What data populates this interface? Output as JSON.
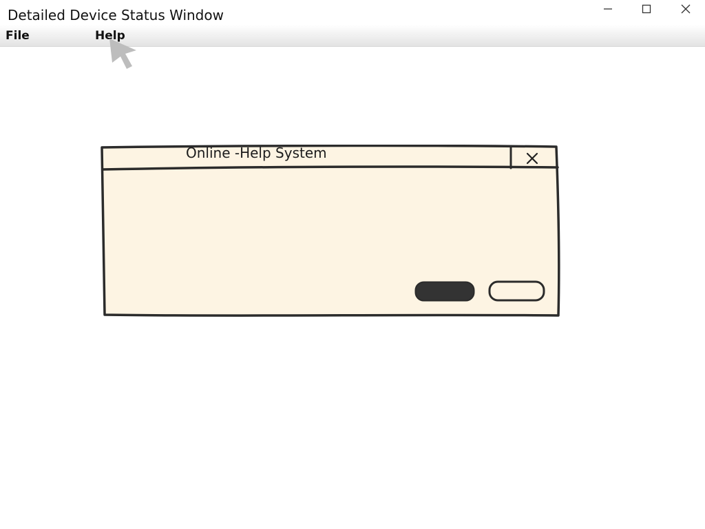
{
  "window": {
    "title": "Detailed Device Status Window",
    "controls": {
      "minimize_icon": "minimize-icon",
      "maximize_icon": "maximize-icon",
      "close_icon": "close-icon"
    }
  },
  "menu": {
    "items": [
      {
        "label": "File"
      },
      {
        "label": "Help"
      }
    ]
  },
  "dialog": {
    "title": "Online -Help System",
    "close_icon": "close-icon",
    "background": "#fdf4e3",
    "border": "#2b2b2b",
    "primary_button": {
      "label": "",
      "fill": "#333333"
    },
    "secondary_button": {
      "label": "",
      "fill": "#fdf4e3"
    }
  },
  "cursor": {
    "icon": "mouse-pointer-icon",
    "color": "#bdbdbd"
  }
}
